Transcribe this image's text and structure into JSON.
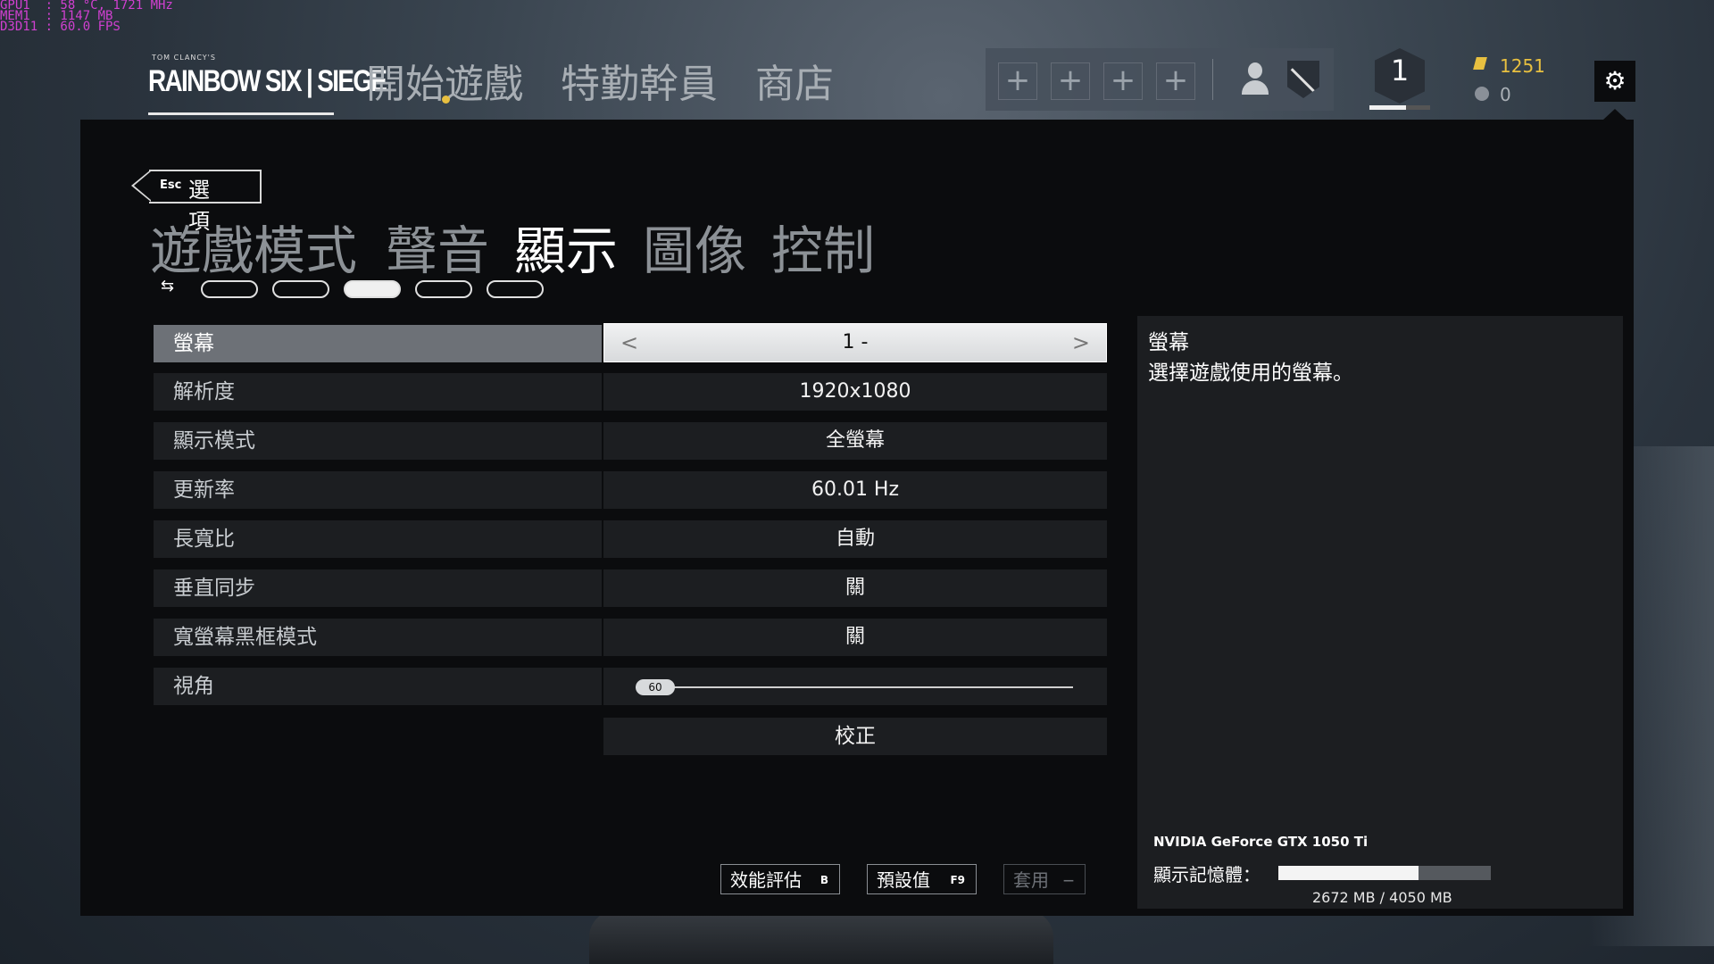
{
  "overlay": {
    "line1": "GPU1  : 58 °C, 1721 MHz",
    "line2": "MEM1  : 1147 MB",
    "line3": "D3D11 : 60.0 FPS"
  },
  "topbar": {
    "logo_small": "TOM CLANCY'S",
    "logo": "RAINBOW SIX | SIEGE",
    "nav": [
      "開始遊戲",
      "特勤幹員",
      "商店"
    ],
    "squad_slot": "+",
    "level": "1",
    "level_progress": 0.6,
    "credits": "1251",
    "renown": "0",
    "gear_icon": "⚙"
  },
  "options": {
    "back_key": "Esc",
    "back_label": "選項",
    "tabs": [
      "遊戲模式",
      "聲音",
      "顯示",
      "圖像",
      "控制"
    ],
    "active_tab": 2,
    "pager_count": 5,
    "pager_active": 2
  },
  "settings": [
    {
      "label": "螢幕",
      "value": "1 -"
    },
    {
      "label": "解析度",
      "value": "1920x1080"
    },
    {
      "label": "顯示模式",
      "value": "全螢幕"
    },
    {
      "label": "更新率",
      "value": "60.01 Hz"
    },
    {
      "label": "長寬比",
      "value": "自動"
    },
    {
      "label": "垂直同步",
      "value": "關"
    },
    {
      "label": "寬螢幕黑框模式",
      "value": "關"
    },
    {
      "label": "視角",
      "value": "60"
    }
  ],
  "calibrate_label": "校正",
  "footer": {
    "benchmark": "效能評估",
    "benchmark_key": "B",
    "defaults": "預設值",
    "defaults_key": "F9",
    "apply": "套用",
    "apply_key": "—"
  },
  "info": {
    "title": "螢幕",
    "description": "選擇遊戲使用的螢幕。",
    "gpu": "NVIDIA GeForce GTX 1050 Ti",
    "vram_label": "顯示記憶體：",
    "vram_used_mb": 2672,
    "vram_total_mb": 4050,
    "vram_text": "2672 MB / 4050 MB"
  },
  "colors": {
    "accent": "#e8c040",
    "panel": "#0b0c0e",
    "row": "#1c1e21"
  }
}
